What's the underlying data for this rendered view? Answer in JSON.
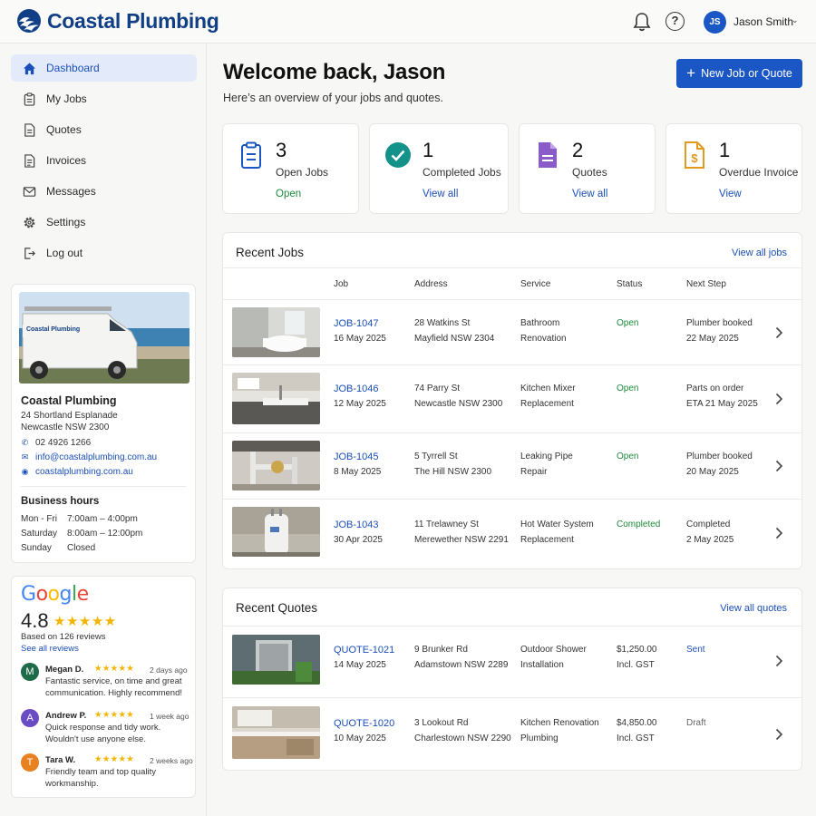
{
  "brand": {
    "name": "Coastal Plumbing",
    "color": "#103f86",
    "accent": "#1a56c4"
  },
  "header": {
    "user_initials": "JS",
    "user_name": "Jason Smith",
    "icons": [
      "bell-icon",
      "help-icon",
      "chevron-down-icon"
    ]
  },
  "sidebar": {
    "items": [
      {
        "label": "Dashboard",
        "icon": "home-icon",
        "active": true
      },
      {
        "label": "My Jobs",
        "icon": "clipboard-icon"
      },
      {
        "label": "Quotes",
        "icon": "document-icon"
      },
      {
        "label": "Invoices",
        "icon": "invoice-icon"
      },
      {
        "label": "Messages",
        "icon": "mail-icon"
      },
      {
        "label": "Settings",
        "icon": "gear-icon"
      },
      {
        "label": "Log out",
        "icon": "logout-icon"
      }
    ],
    "business": {
      "name": "Coastal Plumbing",
      "van_text": "Coastal Plumbing",
      "address_line1": "24 Shortland Esplanade",
      "address_line2": "Newcastle NSW 2300",
      "phone": "02 4926 1266",
      "email": "info@coastalplumbing.com.au",
      "website": "coastalplumbing.com.au",
      "hours_title": "Business hours",
      "hours": [
        {
          "day": "Mon - Fri",
          "time": "7:00am – 4:00pm"
        },
        {
          "day": "Saturday",
          "time": "8:00am – 12:00pm"
        },
        {
          "day": "Sunday",
          "time": "Closed"
        }
      ]
    },
    "reviews": {
      "logo_text": "Google",
      "rating": "4.8",
      "stars": "★★★★★",
      "based_on": "Based on 126 reviews",
      "see_all": "See all reviews",
      "items": [
        {
          "initial": "M",
          "name": "Megan D.",
          "stars": "★★★★★",
          "time": "2 days ago",
          "text": "Fantastic service, on time and great communication. Highly recommend!",
          "color": "#1e6b4a"
        },
        {
          "initial": "A",
          "name": "Andrew P.",
          "stars": "★★★★★",
          "time": "1 week ago",
          "text": "Quick response and tidy work. Wouldn't use anyone else.",
          "color": "#6b4bc4"
        },
        {
          "initial": "T",
          "name": "Tara W.",
          "stars": "★★★★★",
          "time": "2 weeks ago",
          "text": "Friendly team and top quality workmanship.",
          "color": "#e8811f"
        }
      ]
    }
  },
  "main": {
    "welcome": "Welcome back, Jason",
    "subtitle": "Here’s an overview of your jobs and quotes.",
    "new_button": "New Job or Quote",
    "stats": [
      {
        "num": "3",
        "label": "Open Jobs",
        "link": "Open",
        "icon": "clipboard-icon",
        "color": "#1a56c4"
      },
      {
        "num": "1",
        "label": "Completed Jobs",
        "link": "View all",
        "icon": "check-circle-icon",
        "color": "#13928a"
      },
      {
        "num": "2",
        "label": "Quotes",
        "link": "View all",
        "icon": "document-icon",
        "color": "#8a5cc8"
      },
      {
        "num": "1",
        "label": "Overdue Invoice",
        "link": "View",
        "icon": "dollar-document-icon",
        "color": "#e09a1e"
      }
    ],
    "recent_jobs": {
      "title": "Recent Jobs",
      "view_all": "View all jobs",
      "columns": [
        "Job",
        "Address",
        "Service",
        "Status",
        "Next Step"
      ],
      "rows": [
        {
          "id": "JOB-1047",
          "date": "16 May 2025",
          "addr1": "28 Watkins St",
          "addr2": "Mayfield NSW 2304",
          "svc1": "Bathroom",
          "svc2": "Renovation",
          "status": "Open",
          "next1": "Plumber booked",
          "next2": "22 May 2025",
          "photo": "bathroom"
        },
        {
          "id": "JOB-1046",
          "date": "12 May 2025",
          "addr1": "74 Parry St",
          "addr2": "Newcastle NSW 2300",
          "svc1": "Kitchen Mixer",
          "svc2": "Replacement",
          "status": "Open",
          "next1": "Parts on order",
          "next2": "ETA 21 May 2025",
          "photo": "kitchen"
        },
        {
          "id": "JOB-1045",
          "date": "8 May 2025",
          "addr1": "5 Tyrrell St",
          "addr2": "The Hill NSW 2300",
          "svc1": "Leaking Pipe",
          "svc2": "Repair",
          "status": "Open",
          "next1": "Plumber booked",
          "next2": "20 May 2025",
          "photo": "pipes"
        },
        {
          "id": "JOB-1043",
          "date": "30 Apr 2025",
          "addr1": "11 Trelawney St",
          "addr2": "Merewether NSW 2291",
          "svc1": "Hot Water System",
          "svc2": "Replacement",
          "status": "Completed",
          "next1": "Completed",
          "next2": "2 May 2025",
          "photo": "heater"
        }
      ]
    },
    "recent_quotes": {
      "title": "Recent Quotes",
      "view_all": "View all quotes",
      "rows": [
        {
          "id": "QUOTE-1021",
          "date": "14 May 2025",
          "addr1": "9 Brunker Rd",
          "addr2": "Adamstown NSW 2289",
          "svc1": "Outdoor Shower",
          "svc2": "Installation",
          "price1": "$1,250.00",
          "price2": "Incl. GST",
          "status": "Sent",
          "photo": "outdoor"
        },
        {
          "id": "QUOTE-1020",
          "date": "10 May 2025",
          "addr1": "3 Lookout Rd",
          "addr2": "Charlestown NSW 2290",
          "svc1": "Kitchen Renovation",
          "svc2": "Plumbing",
          "price1": "$4,850.00",
          "price2": "Incl. GST",
          "status": "Draft",
          "photo": "kitchen2"
        }
      ]
    }
  }
}
